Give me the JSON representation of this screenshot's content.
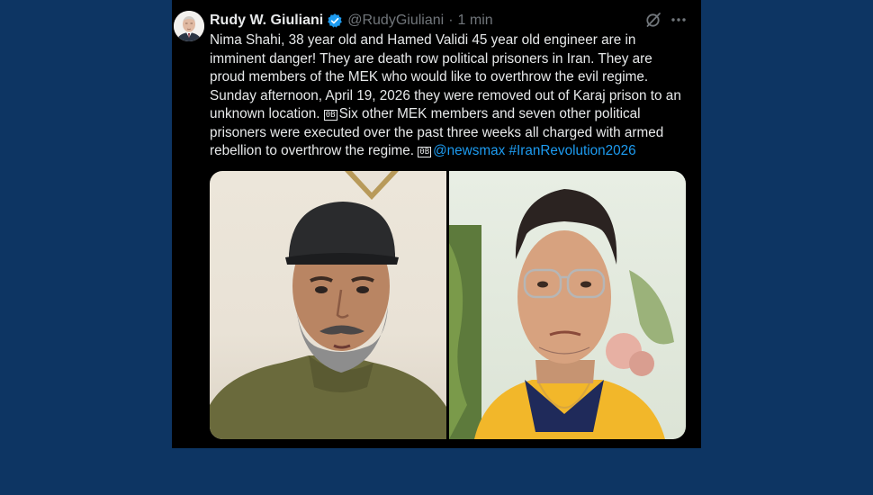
{
  "tweet": {
    "author_name": "Rudy W. Giuliani",
    "handle": "@RudyGiuliani",
    "separator": "·",
    "time": "1 min",
    "text_main": "Nima Shahi, 38 year old and Hamed Validi 45 year old engineer are in imminent danger! They are death row political prisoners in Iran. They are proud members of the MEK who would like to overthrow the evil regime. Sunday afternoon, April 19, 2026 they were removed out of Karaj prison to an unknown location. ",
    "text_glyph1": "0B",
    "text_mid": "Six other MEK members and seven other political prisoners were executed over the past three weeks all charged with armed rebellion to overthrow the regime. ",
    "text_glyph2": "0B",
    "mention": "@newsmax",
    "hashtag": "#IranRevolution2026"
  },
  "colors": {
    "background": "#0d3563",
    "tweet_bg": "#000000",
    "text": "#e7e9ea",
    "secondary": "#71767b",
    "link": "#1d9bf0",
    "verified": "#1d9bf0"
  },
  "icons": {
    "verified": "verified-badge-icon",
    "grok": "grok-icon",
    "more": "more-icon"
  }
}
